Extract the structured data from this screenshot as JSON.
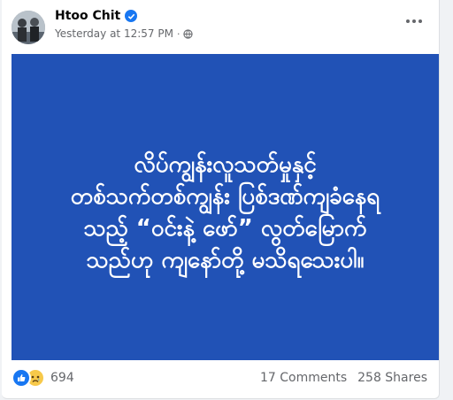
{
  "post": {
    "author": "Htoo Chit",
    "timestamp": "Yesterday at 12:57 PM",
    "separator": "·",
    "privacy_icon": "globe-icon",
    "banner_color": "#2152b6",
    "banner_lines": [
      "လိပ်ကျွန်းလူသတ်မှုနှင့်",
      "တစ်သက်တစ်ကျွန်း ပြစ်ဒဏ်ကျခံနေရ",
      "သည့် “ဝင်းနဲ့ ဖော်” လွတ်မြောက်",
      "သည်ဟု ကျနော်တို့ မသိရသေးပါ။"
    ]
  },
  "footer": {
    "reaction_count": "694",
    "comments": "17 Comments",
    "shares": "258 Shares"
  }
}
